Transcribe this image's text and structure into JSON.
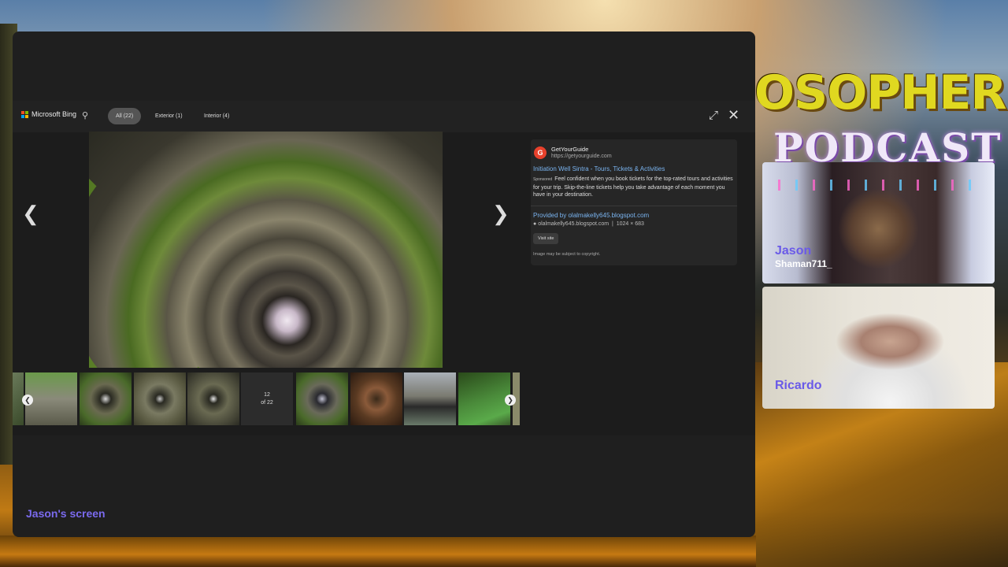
{
  "stream": {
    "title_line1": "OSOPHER",
    "title_line2": "PODCAST",
    "screen_label": "Jason's screen",
    "guests": [
      {
        "name": "Jason",
        "handle": "Shaman711_"
      },
      {
        "name": "Ricardo",
        "handle": ""
      }
    ]
  },
  "bing": {
    "brand": "Microsoft Bing",
    "filters": [
      {
        "label": "All (22)",
        "active": true
      },
      {
        "label": "Exterior (1)",
        "active": false
      },
      {
        "label": "Interior (4)",
        "active": false
      }
    ],
    "icons": [
      "search-icon",
      "expand-icon",
      "close-icon",
      "chevron-left-icon",
      "chevron-right-icon"
    ],
    "ad": {
      "site_name": "GetYourGuide",
      "site_url": "https://getyourguide.com",
      "title": "Initiation Well Sintra - Tours, Tickets & Activities",
      "sponsored_label": "Sponsored",
      "description": "Feel confident when you book tickets for the top-rated tours and activities for your trip. Skip-the-line tickets help you take advantage of each moment you have in your destination."
    },
    "source": {
      "provided_by": "Provided by olalmakelly645.blogspot.com",
      "domain": "olalmakelly645.blogspot.com",
      "dimensions": "1024 × 683",
      "visit_label": "Visit site",
      "copyright": "Image may be subject to copyright."
    },
    "counter": {
      "current": "12",
      "total": "of 22"
    }
  },
  "colors": {
    "accent_purple": "#7a6aee",
    "link_blue": "#7ab4f0",
    "title_yellow": "#e0d820"
  }
}
